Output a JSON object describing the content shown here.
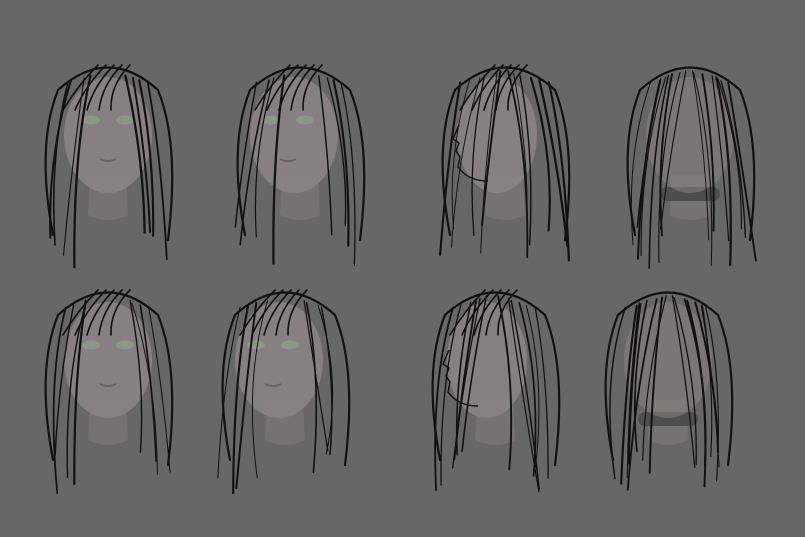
{
  "colors": {
    "background": "#676767",
    "skin": "#8a8385",
    "skin_shade": "#7a7476",
    "hair_line": "#111111",
    "eye": "#8f9a8c",
    "shirt_band": "#4d4d4d"
  },
  "heads": [
    {
      "view": "front"
    },
    {
      "view": "three-quarter"
    },
    {
      "view": "profile"
    },
    {
      "view": "back"
    },
    {
      "view": "front"
    },
    {
      "view": "three-quarter"
    },
    {
      "view": "profile"
    },
    {
      "view": "back"
    }
  ]
}
